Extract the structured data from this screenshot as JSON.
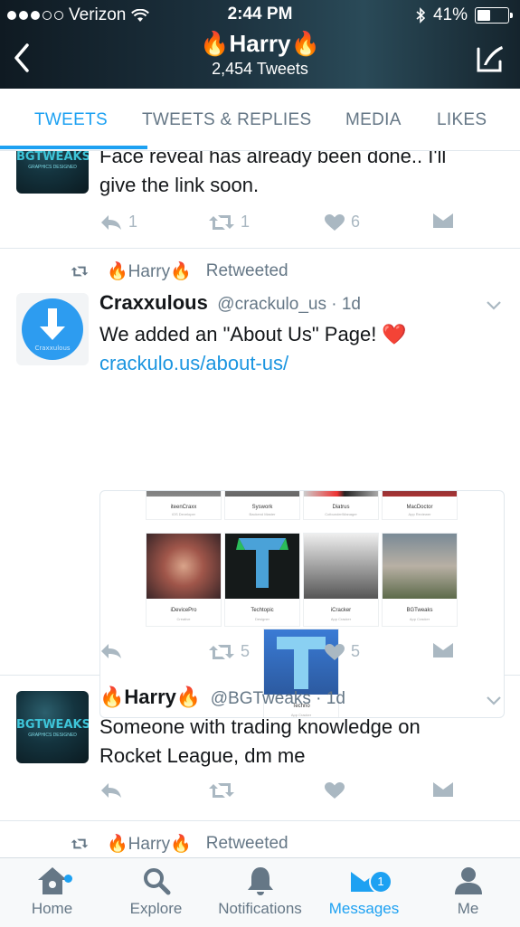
{
  "status_bar": {
    "carrier": "Verizon",
    "time": "2:44 PM",
    "battery": "41%"
  },
  "header": {
    "title": "🔥Harry🔥",
    "subtitle": "2,454 Tweets"
  },
  "tabs": [
    {
      "label": "TWEETS",
      "active": true
    },
    {
      "label": "TWEETS & REPLIES",
      "active": false
    },
    {
      "label": "MEDIA",
      "active": false
    },
    {
      "label": "LIKES",
      "active": false
    }
  ],
  "tweets": [
    {
      "avatar_text": "BGTWEAKS",
      "avatar_subtext": "GRAPHICS DESIGNED",
      "text_lines": [
        "Face reveal has already been done.. I'll",
        "give the link soon."
      ],
      "reply_count": "1",
      "retweet_count": "1",
      "like_count": "6"
    },
    {
      "retweeted_by": "🔥Harry🔥",
      "retweeted_label": "Retweeted",
      "name": "Craxxulous",
      "handle": "@crackulo_us · 1d",
      "avatar_text": "Craxxulous",
      "text": "We added an \"About Us\" Page! ❤️",
      "link": "crackulo.us/about-us/",
      "card": {
        "members": [
          {
            "name": "iteenCraxx",
            "role": "iOS Developer"
          },
          {
            "name": "Syswork",
            "role": "Backend Master"
          },
          {
            "name": "Diatrus",
            "role": "Cofounder/Manager"
          },
          {
            "name": "MacDoctor",
            "role": "App Reviewer"
          },
          {
            "name": "iDevicePro",
            "role": "Creative"
          },
          {
            "name": "Techtopic",
            "role": "Designer"
          },
          {
            "name": "iCracker",
            "role": "App Cracker"
          },
          {
            "name": "BGTweaks",
            "role": "App Cracker"
          },
          {
            "name": "Techno",
            "role": "App Cracker"
          }
        ]
      },
      "reply_count": "",
      "retweet_count": "5",
      "like_count": "5"
    },
    {
      "name": "🔥Harry🔥",
      "handle": "@BGTweaks · 1d",
      "avatar_text": "BGTWEAKS",
      "avatar_subtext": "GRAPHICS DESIGNED",
      "text_lines": [
        "Someone with trading knowledge on",
        "Rocket League, dm me"
      ],
      "reply_count": "",
      "retweet_count": "",
      "like_count": ""
    },
    {
      "retweeted_by": "🔥Harry🔥",
      "retweeted_label": "Retweeted"
    }
  ],
  "bottom_nav": [
    {
      "label": "Home",
      "icon": "home-icon"
    },
    {
      "label": "Explore",
      "icon": "search-icon"
    },
    {
      "label": "Notifications",
      "icon": "bell-icon"
    },
    {
      "label": "Messages",
      "icon": "envelope-icon",
      "badge": "1",
      "active": true
    },
    {
      "label": "Me",
      "icon": "person-icon"
    }
  ],
  "colors": {
    "accent": "#1da1f2",
    "muted": "#657786",
    "icon_gray": "#aab8c2",
    "link": "#1b95e0"
  }
}
